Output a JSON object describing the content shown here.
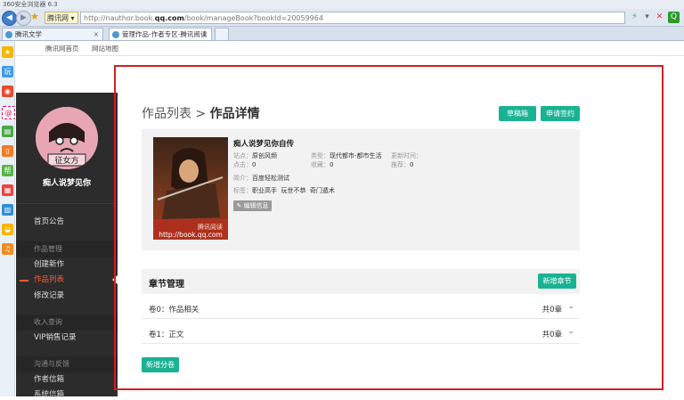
{
  "browser": {
    "title": "360安全浏览器 6.3",
    "url_prefix": "http://nauthor.book.",
    "url_domain": "qq.com",
    "url_suffix": "/book/manageBook?bookId=20059964",
    "brand_label": "腾讯网",
    "tabs": [
      {
        "label": "腾讯文学"
      },
      {
        "label": "管理作品-作者专区-腾讯阅读"
      }
    ]
  },
  "topnav": {
    "links": [
      "腾讯网首页",
      "网站地图"
    ]
  },
  "sidebar": {
    "username": "痴人说梦见你",
    "avatar_text": "征女方",
    "items": [
      {
        "label": "首页公告",
        "type": "item"
      },
      {
        "label": "作品管理",
        "type": "group"
      },
      {
        "label": "创建新作",
        "type": "item"
      },
      {
        "label": "作品列表",
        "type": "item",
        "active": true
      },
      {
        "label": "修改记录",
        "type": "item"
      },
      {
        "label": "收入查询",
        "type": "group"
      },
      {
        "label": "VIP销售记录",
        "type": "item"
      },
      {
        "label": "沟通与反馈",
        "type": "group"
      },
      {
        "label": "作者信箱",
        "type": "item"
      },
      {
        "label": "系统信箱",
        "type": "item"
      }
    ]
  },
  "main": {
    "breadcrumb_parent": "作品列表 > ",
    "breadcrumb_current": "作品详情",
    "draft_button": "草稿箱",
    "sign_button": "申请签约",
    "book": {
      "title": "痴人说梦见你自传",
      "cover_brand": "腾讯阅读",
      "cover_url": "http://book.qq.com",
      "site_label": "站点：",
      "site": "原创风频",
      "type_label": "类型：",
      "type": "现代都市-都市生活",
      "update_label": "更新时间：",
      "update": "",
      "clicks_label": "点击：",
      "clicks": "0",
      "favs_label": "收藏：",
      "favs": "0",
      "recs_label": "推荐：",
      "recs": "0",
      "intro_label": "简介：",
      "intro": "百度轻松测试",
      "tags_label": "标签：",
      "tags": [
        "职业高手",
        "玩世不恭",
        "奇门遁术"
      ],
      "edit_button": "✎ 编辑信息"
    },
    "chapters": {
      "title": "章节管理",
      "add_chapter_button": "新增章节",
      "volumes": [
        {
          "name": "卷0：作品相关",
          "count": "共0章"
        },
        {
          "name": "卷1：正文",
          "count": "共0章"
        }
      ],
      "add_volume_button": "新增分卷"
    }
  },
  "colors": {
    "accent": "#19b394",
    "active_nav": "#ff5a3a",
    "highlight_border": "#d21f26"
  }
}
